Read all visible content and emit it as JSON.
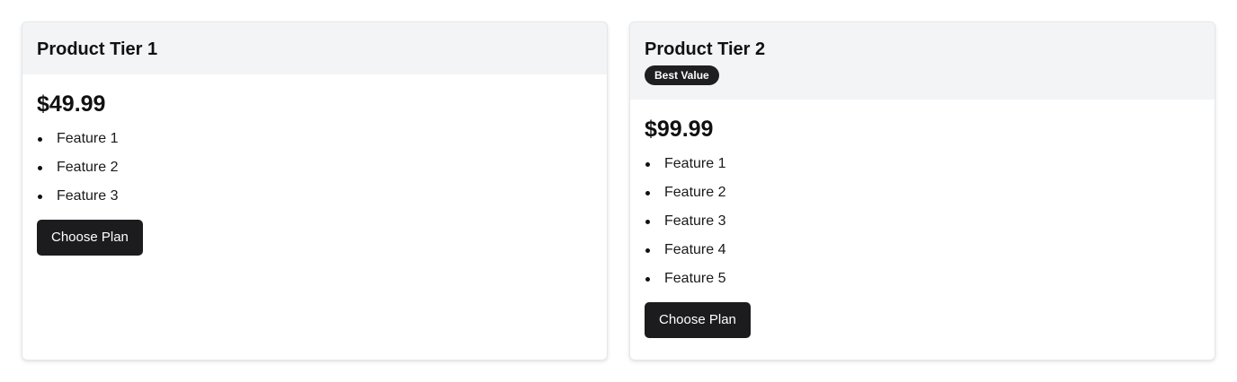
{
  "plans": [
    {
      "title": "Product Tier 1",
      "badge": "",
      "price": "$49.99",
      "features": [
        "Feature 1",
        "Feature 2",
        "Feature 3"
      ],
      "button_label": "Choose Plan"
    },
    {
      "title": "Product Tier 2",
      "badge": "Best Value",
      "price": "$99.99",
      "features": [
        "Feature 1",
        "Feature 2",
        "Feature 3",
        "Feature 4",
        "Feature 5"
      ],
      "button_label": "Choose Plan"
    }
  ],
  "colors": {
    "header_bg": "#f3f4f6",
    "button_bg": "#1c1c1f",
    "badge_bg": "#1f1f22",
    "border": "#e5e7eb"
  }
}
